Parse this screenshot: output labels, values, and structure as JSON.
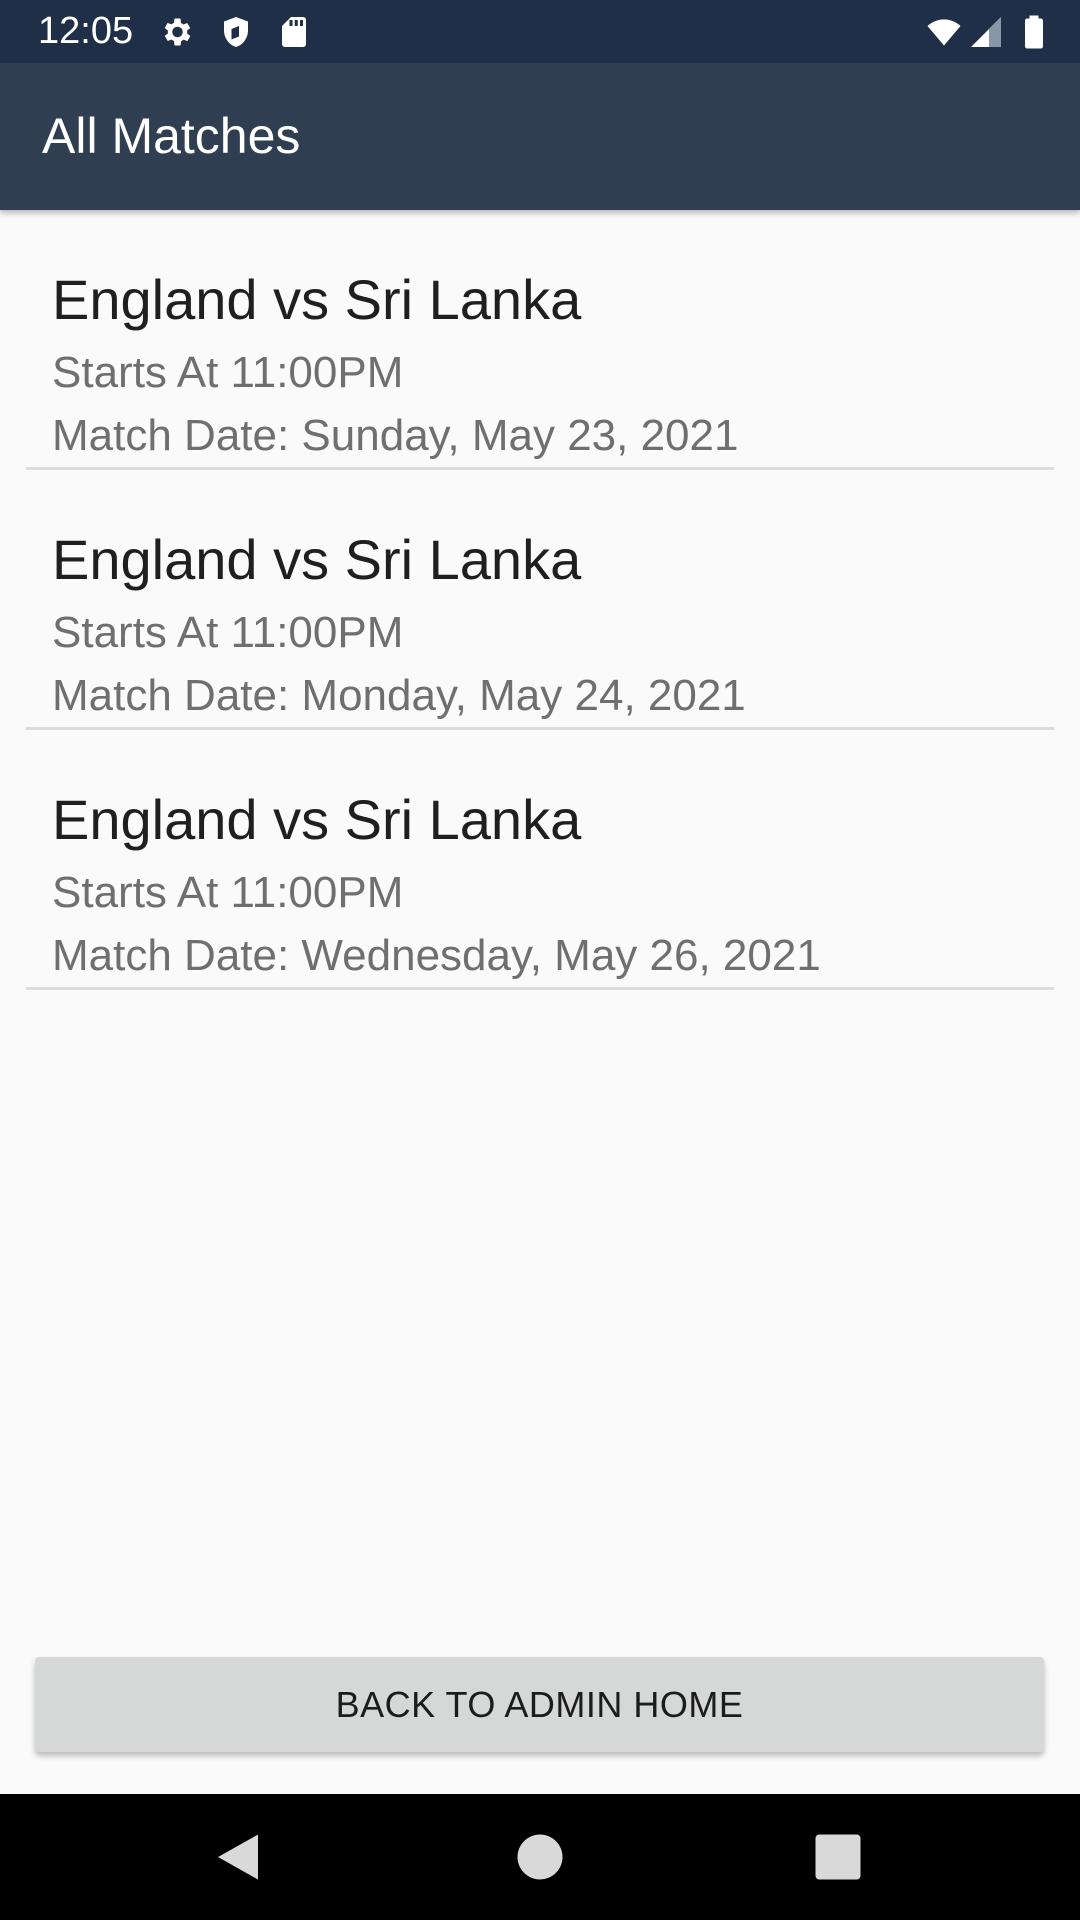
{
  "status_bar": {
    "time": "12:05",
    "icons": [
      "gear-icon",
      "shield-icon",
      "sd-card-icon",
      "wifi-icon",
      "signal-icon",
      "battery-icon"
    ]
  },
  "app_bar": {
    "title": "All Matches"
  },
  "matches": [
    {
      "title": "England vs Sri Lanka",
      "time": "Starts At 11:00PM",
      "date": "Match Date: Sunday, May 23, 2021"
    },
    {
      "title": "England vs Sri Lanka",
      "time": "Starts At 11:00PM",
      "date": "Match Date: Monday, May 24, 2021"
    },
    {
      "title": "England vs Sri Lanka",
      "time": "Starts At 11:00PM",
      "date": "Match Date: Wednesday, May 26, 2021"
    }
  ],
  "actions": {
    "back_label": "BACK TO ADMIN HOME"
  },
  "nav_bar": {
    "icons": [
      "back-triangle-icon",
      "home-circle-icon",
      "recents-square-icon"
    ]
  },
  "colors": {
    "status_bar": "#1e2f47",
    "app_bar": "#2f3e51",
    "background": "#fafafa",
    "button": "#d6d7d7"
  }
}
